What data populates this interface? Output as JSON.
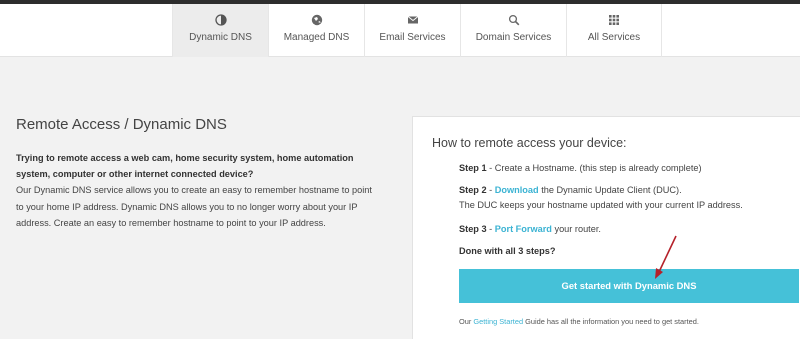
{
  "nav": {
    "tabs": [
      {
        "label": "Dynamic DNS",
        "icon": "globe-icon",
        "active": true
      },
      {
        "label": "Managed DNS",
        "icon": "globe-icon"
      },
      {
        "label": "Email Services",
        "icon": "envelope-icon"
      },
      {
        "label": "Domain Services",
        "icon": "search-icon"
      },
      {
        "label": "All Services",
        "icon": "grid-icon"
      }
    ]
  },
  "left": {
    "title": "Remote Access / Dynamic DNS",
    "intro_bold": "Trying to remote access a web cam, home security system, home automation system, computer or other internet connected device?",
    "body": "Our Dynamic DNS service allows you to create an easy to remember hostname to point to your home IP address. Dynamic DNS allows you to no longer worry about your IP address. Create an easy to remember hostname to point to your IP address."
  },
  "panel": {
    "title": "How to remote access your device:",
    "step1": {
      "label": "Step 1",
      "sep": " - ",
      "text": "Create a Hostname. (this step is already complete)"
    },
    "step2": {
      "label": "Step 2",
      "sep": " - ",
      "link": "Download",
      "text": " the Dynamic Update Client (DUC).",
      "line2": "The DUC keeps your hostname updated with your current IP address."
    },
    "step3": {
      "label": "Step 3",
      "sep": " - ",
      "link": "Port Forward",
      "text": " your router."
    },
    "done": "Done with all 3 steps?",
    "cta": "Get started with Dynamic DNS",
    "guide": {
      "prefix": "Our ",
      "link": "Getting Started",
      "suffix": " Guide has all the information you need to get started."
    }
  },
  "colors": {
    "accent": "#45c1d8",
    "link": "#3bb3d3",
    "arrow": "#b5212a"
  }
}
